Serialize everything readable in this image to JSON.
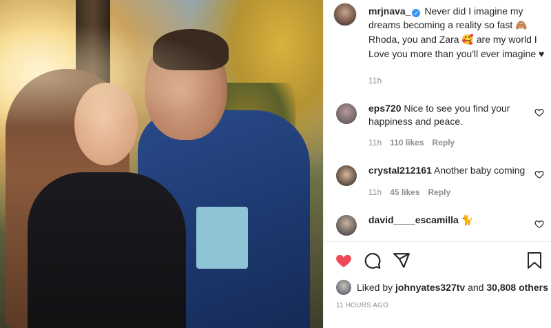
{
  "post": {
    "username": "mrjnava_",
    "caption_part1": "Never did I imagine my dreams becoming a reality so fast ",
    "caption_emoji1": "🙈",
    "caption_part2": " Rhoda, you and Zara ",
    "caption_emoji2": "🥰",
    "caption_part3": " are my world I Love you more than you'll ever imagine ",
    "caption_heart": "♥",
    "time": "11h"
  },
  "comments": [
    {
      "username": "eps720",
      "text": "Nice to see you find your happiness and peace.",
      "time": "11h",
      "likes": "110 likes",
      "reply": "Reply"
    },
    {
      "username": "crystal212161",
      "text": "Another baby coming",
      "time": "11h",
      "likes": "45 likes",
      "reply": "Reply"
    },
    {
      "username": "david____escamilla",
      "text": "🐈",
      "time": "",
      "likes": "",
      "reply": ""
    }
  ],
  "footer": {
    "liked_by_prefix": "Liked by ",
    "liked_by_user": "johnyates327tv",
    "liked_by_mid": " and ",
    "liked_by_count": "30,808 others",
    "timestamp": "11 HOURS AGO"
  },
  "icons": {
    "like": "heart-filled-icon",
    "comment": "comment-bubble-icon",
    "share": "paper-plane-icon",
    "save": "bookmark-icon",
    "comment_like": "heart-outline-icon"
  },
  "colors": {
    "like_red": "#ed4956",
    "verified_blue": "#3897f0",
    "meta_gray": "#8e8e8e"
  }
}
